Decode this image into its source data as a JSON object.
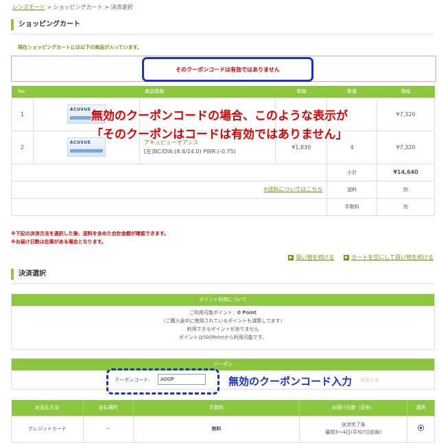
{
  "breadcrumb": {
    "home": "レンズモード",
    "sep1": ">",
    "cart": "ショッピングカート",
    "sep2": ">",
    "current": "決済選択"
  },
  "cart": {
    "title": "ショッピングカート",
    "notice": "現在ショッピングカートには以下の商品が入っています。",
    "error": "そのクーポンコードは有効ではありません",
    "headers": {
      "no": "No",
      "product": "商品情報",
      "unit_price": "単価",
      "qty": "数量",
      "price": "価格"
    },
    "items": [
      {
        "no": "1",
        "thumb_text": "ACUVUE",
        "name": "",
        "spec": "",
        "unit": "",
        "qty": "",
        "price": "¥7,320"
      },
      {
        "no": "2",
        "thumb_text": "ACUVUE",
        "name": "アキュビューオアシス",
        "spec": "[左]BC/DIA:(8.4/14.0) PWR:(-0.75)",
        "unit": "¥1,830",
        "qty": "4",
        "price": "¥7,320"
      }
    ],
    "subtotal_label": "小計",
    "subtotal": "¥14,640",
    "shipping_link": "※送料についてはこちら",
    "shipping_label": "送料",
    "shipping_value": "別",
    "fee_label": "手数料",
    "fee_value": "別"
  },
  "overlay_note": {
    "line1": "無効のクーポンコードの場合、このような表示が",
    "line2": "「そのクーポンはコードは有効ではありません」"
  },
  "notes": [
    "※下記の決済方法を選択した後、送料を含めた合計金額が確認できます。",
    "※お届け日数は在庫がある場合となります。"
  ],
  "links": {
    "continue": "買い物を続ける",
    "empty_continue": "カートを空にして買い物を続ける",
    "arrow": "▶"
  },
  "payment": {
    "title": "決済選択",
    "points": {
      "header": "ポイント利用について",
      "available_label": "ご利用可能ポイント：",
      "available_value": "0 Point",
      "line2": "（ご購入途中に使用されているポイントも減算してます）",
      "line3": "利用できるポイントがありません",
      "line4": "ポイントは500Pointから利用可能です。"
    },
    "coupon": {
      "header": "クーポン",
      "label": "クーポンコード:",
      "value": "AOOP",
      "apply_ghost": "適用する"
    },
    "coupon_caption": "無効のクーポンコード入力",
    "table": {
      "headers": {
        "method": "お支払方法",
        "place": "支払場所",
        "fee": "手数料",
        "delivery": "お届け日数（目安）",
        "select": "選択"
      },
      "rows": [
        {
          "method": "クレジットカード",
          "place": "－",
          "fee": "無料",
          "delivery1": "決済完了後",
          "delivery2": "最短3～4日(平均7日前後)"
        }
      ]
    }
  },
  "colors": {
    "accent": "#8cc63f",
    "link": "#6a9a10",
    "error": "#d40000",
    "annotation": "#1a2fd0"
  }
}
